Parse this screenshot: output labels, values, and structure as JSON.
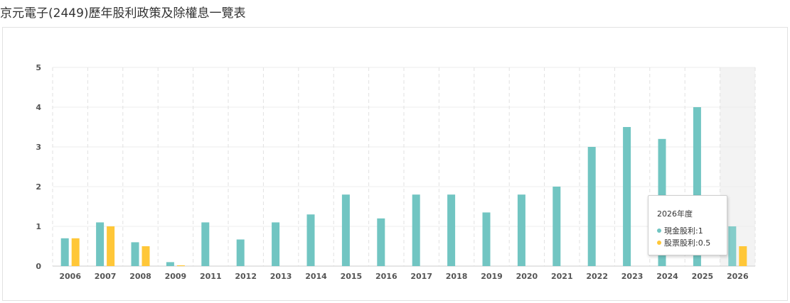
{
  "title": "京元電子(2449)歷年股利政策及除權息一覽表",
  "colors": {
    "cash": "#71c5c2",
    "stock": "#ffc738",
    "highlight": "#f3f3f3"
  },
  "tooltip": {
    "title": "2026年度",
    "rows": [
      {
        "label": "現金股利:",
        "value": "1",
        "color": "#71c5c2"
      },
      {
        "label": "股票股利:",
        "value": "0.5",
        "color": "#ffc738"
      }
    ]
  },
  "chart_data": {
    "type": "bar",
    "categories": [
      "2006",
      "2007",
      "2008",
      "2009",
      "2011",
      "2012",
      "2013",
      "2014",
      "2015",
      "2016",
      "2017",
      "2018",
      "2019",
      "2020",
      "2021",
      "2022",
      "2023",
      "2024",
      "2025",
      "2026"
    ],
    "series": [
      {
        "name": "現金股利",
        "color": "#71c5c2",
        "values": [
          0.7,
          1.1,
          0.6,
          0.1,
          1.1,
          0.67,
          1.1,
          1.3,
          1.8,
          1.2,
          1.8,
          1.8,
          1.35,
          1.8,
          2.0,
          3.0,
          3.5,
          3.2,
          4.0,
          1.0
        ]
      },
      {
        "name": "股票股利",
        "color": "#ffc738",
        "values": [
          0.7,
          1.0,
          0.5,
          0.02,
          0,
          0,
          0,
          0,
          0,
          0,
          0,
          0,
          0,
          0,
          0,
          0,
          0,
          0,
          0,
          0.5
        ]
      }
    ],
    "yticks": [
      0,
      1,
      2,
      3,
      4,
      5
    ],
    "ylim": [
      0,
      5
    ],
    "highlighted_category": "2026",
    "grid": true
  }
}
